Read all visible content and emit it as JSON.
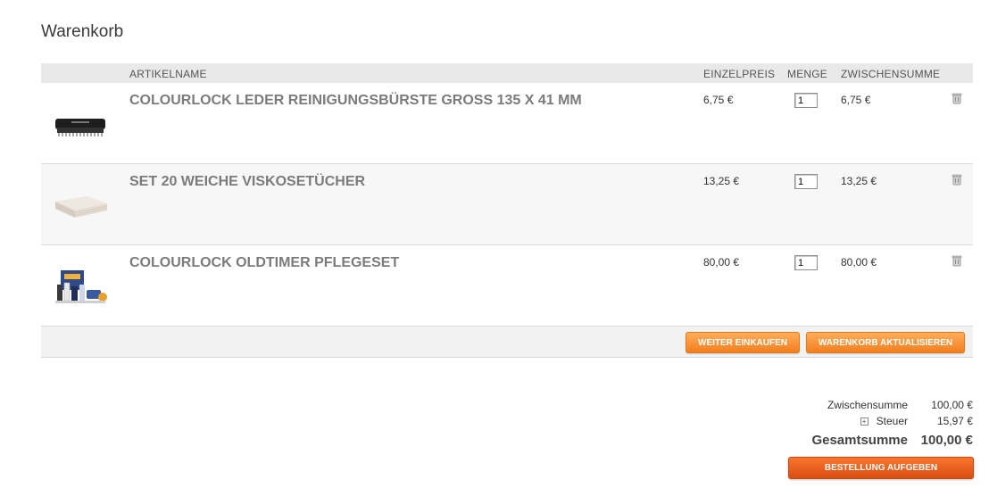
{
  "title": "Warenkorb",
  "columns": {
    "name": "ARTIKELNAME",
    "unit_price": "EINZELPREIS",
    "quantity": "MENGE",
    "subtotal": "ZWISCHENSUMME"
  },
  "items": [
    {
      "name": "COLOURLOCK LEDER REINIGUNGSBÜRSTE GROSS 135 X 41 MM",
      "unit_price": "6,75 €",
      "quantity": "1",
      "subtotal": "6,75 €",
      "image_icon": "brush-product"
    },
    {
      "name": "SET 20 WEICHE VISKOSETÜCHER",
      "unit_price": "13,25 €",
      "quantity": "1",
      "subtotal": "13,25 €",
      "image_icon": "cloth-stack-product"
    },
    {
      "name": "COLOURLOCK OLDTIMER PFLEGESET",
      "unit_price": "80,00 €",
      "quantity": "1",
      "subtotal": "80,00 €",
      "image_icon": "care-kit-product"
    }
  ],
  "actions": {
    "continue_label": "WEITER EINKAUFEN",
    "update_label": "WARENKORB AKTUALISIEREN"
  },
  "totals": {
    "subtotal_label": "Zwischensumme",
    "subtotal_value": "100,00 €",
    "tax_label": "Steuer",
    "tax_value": "15,97 €",
    "grand_label": "Gesamtsumme",
    "grand_value": "100,00 €"
  },
  "checkout_label": "BESTELLUNG AUFGEBEN",
  "colors": {
    "button_orange": "#f27e1e",
    "checkout_orange": "#dc4e12",
    "header_gray": "#e9e9e9"
  }
}
